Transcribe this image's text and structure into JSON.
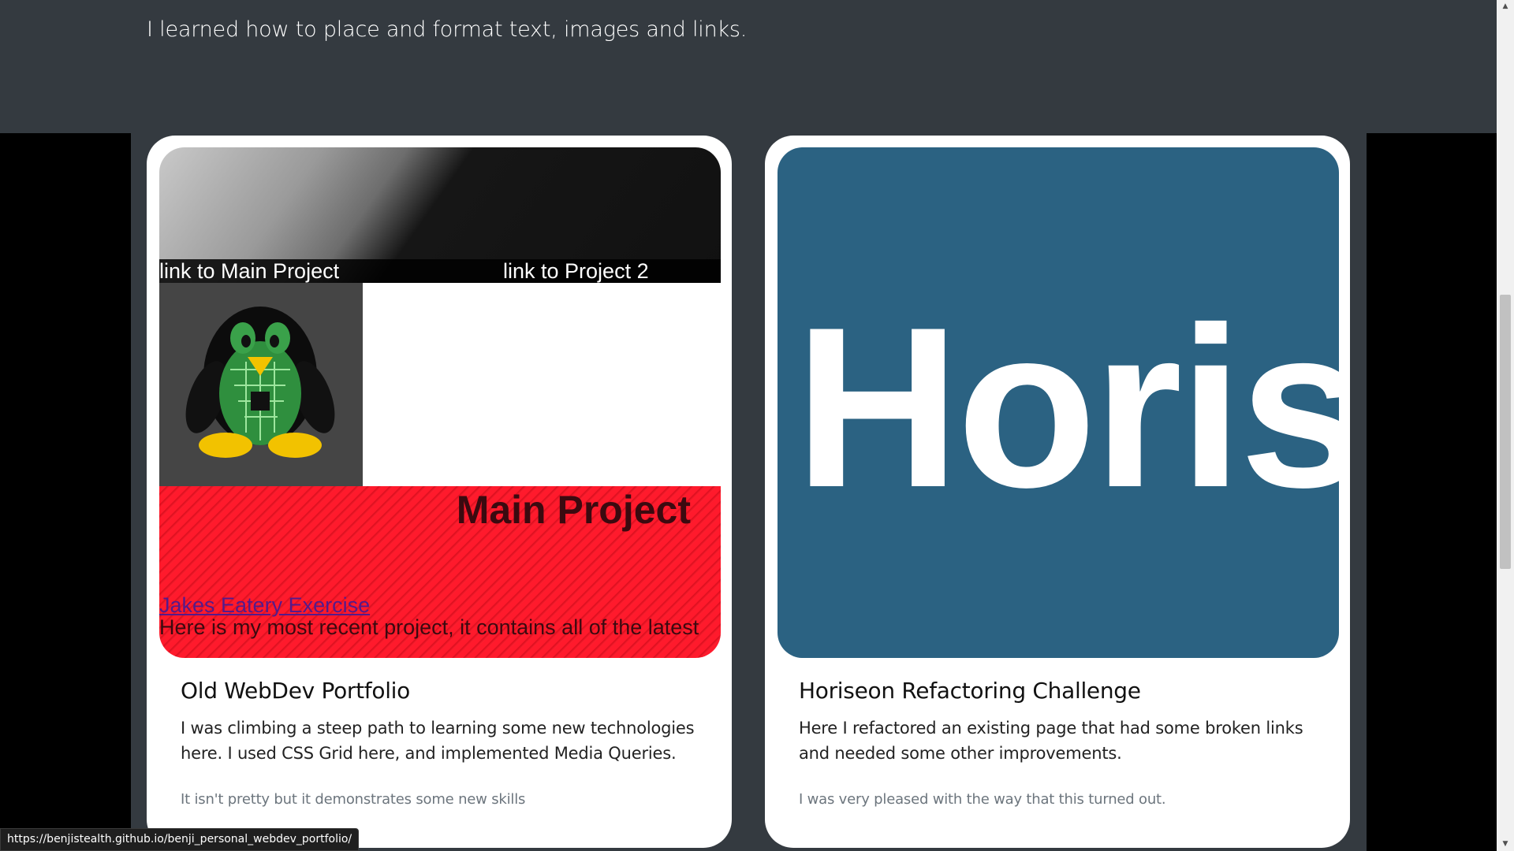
{
  "intro": {
    "text": "I learned how to place and format text, images and links."
  },
  "cards": [
    {
      "title": "Old WebDev Portfolio",
      "text": "I was climbing a steep path to learning some new technologies here. I used CSS Grid here, and implemented Media Queries.",
      "muted": "It isn't pretty but it demonstrates some new skills",
      "screenshot": {
        "link_main": "link to Main Project",
        "link_project2": "link to Project 2",
        "main_heading": "Main Project",
        "eatery_link": "Jakes Eatery Exercise",
        "recent_text": "Here is my most recent project, it contains all of the latest"
      }
    },
    {
      "title": "Horiseon Refactoring Challenge",
      "text": "Here I refactored an existing page that had some broken links and needed some other improvements.",
      "muted": "I was very pleased with the way that this turned out.",
      "screenshot": {
        "logo_text": "Horiseon"
      }
    }
  ],
  "status_bar": {
    "url": "https://benjistealth.github.io/benji_personal_webdev_portfolio/"
  },
  "scrollbar": {
    "up_arrow": "▲",
    "down_arrow": "▼"
  },
  "colors": {
    "intro_background": "#343a40",
    "page_background": "#000000",
    "card_background": "#ffffff",
    "horiseon_blue": "#2b6282",
    "muted_text": "#6c757d"
  }
}
